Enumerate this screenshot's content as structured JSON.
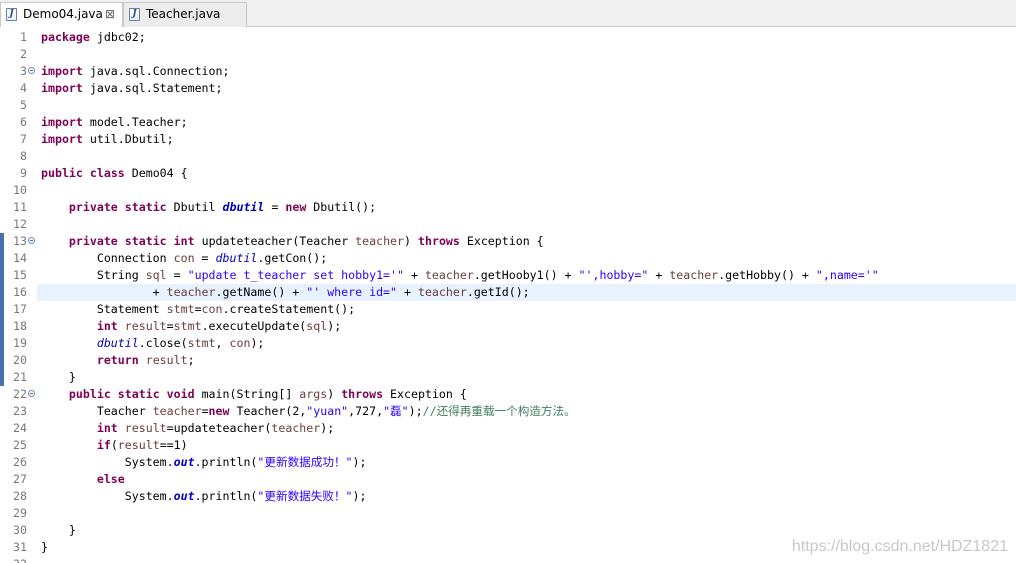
{
  "tabs": [
    {
      "label": "Demo04.java",
      "active": true,
      "icon": "java-file-icon",
      "close": "⊠"
    },
    {
      "label": "Teacher.java",
      "active": false,
      "icon": "java-file-icon"
    }
  ],
  "icon_letter": "J",
  "editor": {
    "current_line": 16,
    "changed_lines": [
      13,
      14,
      15,
      16,
      17,
      18,
      19,
      20,
      21
    ],
    "folds": [
      3,
      13,
      22
    ],
    "lines": [
      {
        "n": "1",
        "tokens": [
          [
            "kw",
            "package"
          ],
          [
            "p",
            " jdbc02;"
          ]
        ]
      },
      {
        "n": "2",
        "tokens": []
      },
      {
        "n": "3",
        "tokens": [
          [
            "kw",
            "import"
          ],
          [
            "p",
            " java.sql.Connection;"
          ]
        ]
      },
      {
        "n": "4",
        "tokens": [
          [
            "kw",
            "import"
          ],
          [
            "p",
            " java.sql.Statement;"
          ]
        ]
      },
      {
        "n": "5",
        "tokens": []
      },
      {
        "n": "6",
        "tokens": [
          [
            "kw",
            "import"
          ],
          [
            "p",
            " model.Teacher;"
          ]
        ]
      },
      {
        "n": "7",
        "tokens": [
          [
            "kw",
            "import"
          ],
          [
            "p",
            " util.Dbutil;"
          ]
        ]
      },
      {
        "n": "8",
        "tokens": []
      },
      {
        "n": "9",
        "tokens": [
          [
            "kw",
            "public"
          ],
          [
            "p",
            " "
          ],
          [
            "kw",
            "class"
          ],
          [
            "p",
            " Demo04 {"
          ]
        ]
      },
      {
        "n": "10",
        "tokens": []
      },
      {
        "n": "11",
        "tokens": [
          [
            "p",
            "    "
          ],
          [
            "kw",
            "private"
          ],
          [
            "p",
            " "
          ],
          [
            "kw",
            "static"
          ],
          [
            "p",
            " Dbutil "
          ],
          [
            "sfld",
            "dbutil"
          ],
          [
            "p",
            " = "
          ],
          [
            "kw",
            "new"
          ],
          [
            "p",
            " Dbutil();"
          ]
        ]
      },
      {
        "n": "12",
        "tokens": []
      },
      {
        "n": "13",
        "tokens": [
          [
            "p",
            "    "
          ],
          [
            "kw",
            "private"
          ],
          [
            "p",
            " "
          ],
          [
            "kw",
            "static"
          ],
          [
            "p",
            " "
          ],
          [
            "kw",
            "int"
          ],
          [
            "p",
            " updateteacher(Teacher "
          ],
          [
            "loc",
            "teacher"
          ],
          [
            "p",
            ") "
          ],
          [
            "kw",
            "throws"
          ],
          [
            "p",
            " Exception {"
          ]
        ]
      },
      {
        "n": "14",
        "tokens": [
          [
            "p",
            "        Connection "
          ],
          [
            "loc",
            "con"
          ],
          [
            "p",
            " = "
          ],
          [
            "fld",
            "dbutil"
          ],
          [
            "p",
            ".getCon();"
          ]
        ]
      },
      {
        "n": "15",
        "tokens": [
          [
            "p",
            "        String "
          ],
          [
            "loc",
            "sql"
          ],
          [
            "p",
            " = "
          ],
          [
            "str",
            "\"update t_teacher set hobby1='\""
          ],
          [
            "p",
            " + "
          ],
          [
            "loc",
            "teacher"
          ],
          [
            "p",
            ".getHooby1() + "
          ],
          [
            "str",
            "\"',hobby=\""
          ],
          [
            "p",
            " + "
          ],
          [
            "loc",
            "teacher"
          ],
          [
            "p",
            ".getHobby() + "
          ],
          [
            "str",
            "\",name='\""
          ]
        ]
      },
      {
        "n": "16",
        "tokens": [
          [
            "p",
            "                + "
          ],
          [
            "loc",
            "teacher"
          ],
          [
            "p",
            ".getName() + "
          ],
          [
            "str",
            "\"' where id=\""
          ],
          [
            "p",
            " + "
          ],
          [
            "loc",
            "teacher"
          ],
          [
            "p",
            ".getId();"
          ]
        ]
      },
      {
        "n": "17",
        "tokens": [
          [
            "p",
            "        Statement "
          ],
          [
            "loc",
            "stmt"
          ],
          [
            "p",
            "="
          ],
          [
            "loc",
            "con"
          ],
          [
            "p",
            ".createStatement();"
          ]
        ]
      },
      {
        "n": "18",
        "tokens": [
          [
            "p",
            "        "
          ],
          [
            "kw",
            "int"
          ],
          [
            "p",
            " "
          ],
          [
            "loc",
            "result"
          ],
          [
            "p",
            "="
          ],
          [
            "loc",
            "stmt"
          ],
          [
            "p",
            ".executeUpdate("
          ],
          [
            "loc",
            "sql"
          ],
          [
            "p",
            ");"
          ]
        ]
      },
      {
        "n": "19",
        "tokens": [
          [
            "p",
            "        "
          ],
          [
            "fld",
            "dbutil"
          ],
          [
            "p",
            ".close("
          ],
          [
            "loc",
            "stmt"
          ],
          [
            "p",
            ", "
          ],
          [
            "loc",
            "con"
          ],
          [
            "p",
            ");"
          ]
        ]
      },
      {
        "n": "20",
        "tokens": [
          [
            "p",
            "        "
          ],
          [
            "kw",
            "return"
          ],
          [
            "p",
            " "
          ],
          [
            "loc",
            "result"
          ],
          [
            "p",
            ";"
          ]
        ]
      },
      {
        "n": "21",
        "tokens": [
          [
            "p",
            "    }"
          ]
        ]
      },
      {
        "n": "22",
        "tokens": [
          [
            "p",
            "    "
          ],
          [
            "kw",
            "public"
          ],
          [
            "p",
            " "
          ],
          [
            "kw",
            "static"
          ],
          [
            "p",
            " "
          ],
          [
            "kw",
            "void"
          ],
          [
            "p",
            " main(String[] "
          ],
          [
            "loc",
            "args"
          ],
          [
            "p",
            ") "
          ],
          [
            "kw",
            "throws"
          ],
          [
            "p",
            " Exception {"
          ]
        ]
      },
      {
        "n": "23",
        "tokens": [
          [
            "p",
            "        Teacher "
          ],
          [
            "loc",
            "teacher"
          ],
          [
            "p",
            "="
          ],
          [
            "kw",
            "new"
          ],
          [
            "p",
            " Teacher(2,"
          ],
          [
            "str",
            "\"yuan\""
          ],
          [
            "p",
            ",727,"
          ],
          [
            "str",
            "\"磊\""
          ],
          [
            "p",
            ");"
          ],
          [
            "cmt",
            "//还得再重载一个构造方法。"
          ]
        ]
      },
      {
        "n": "24",
        "tokens": [
          [
            "p",
            "        "
          ],
          [
            "kw",
            "int"
          ],
          [
            "p",
            " "
          ],
          [
            "loc",
            "result"
          ],
          [
            "p",
            "=updateteacher("
          ],
          [
            "loc",
            "teacher"
          ],
          [
            "p",
            ");"
          ]
        ]
      },
      {
        "n": "25",
        "tokens": [
          [
            "p",
            "        "
          ],
          [
            "kw",
            "if"
          ],
          [
            "p",
            "("
          ],
          [
            "loc",
            "result"
          ],
          [
            "p",
            "==1)"
          ]
        ]
      },
      {
        "n": "26",
        "tokens": [
          [
            "p",
            "            System."
          ],
          [
            "sfld",
            "out"
          ],
          [
            "p",
            ".println("
          ],
          [
            "str",
            "\"更新数据成功！\""
          ],
          [
            "p",
            ");"
          ]
        ]
      },
      {
        "n": "27",
        "tokens": [
          [
            "p",
            "        "
          ],
          [
            "kw",
            "else"
          ]
        ]
      },
      {
        "n": "28",
        "tokens": [
          [
            "p",
            "            System."
          ],
          [
            "sfld",
            "out"
          ],
          [
            "p",
            ".println("
          ],
          [
            "str",
            "\"更新数据失败！\""
          ],
          [
            "p",
            ");"
          ]
        ]
      },
      {
        "n": "29",
        "tokens": []
      },
      {
        "n": "30",
        "tokens": [
          [
            "p",
            "    }"
          ]
        ]
      },
      {
        "n": "31",
        "tokens": [
          [
            "p",
            "}"
          ]
        ]
      },
      {
        "n": "32",
        "tokens": []
      }
    ]
  },
  "watermark": "https://blog.csdn.net/HDZ1821",
  "colors": {
    "keyword": "#7f0055",
    "string": "#2a00ff",
    "field": "#0000c0",
    "local_variable": "#6a3e3e",
    "comment": "#3f7f5f",
    "current_line": "#e8f2fe",
    "change_bar": "#4a72b0"
  }
}
